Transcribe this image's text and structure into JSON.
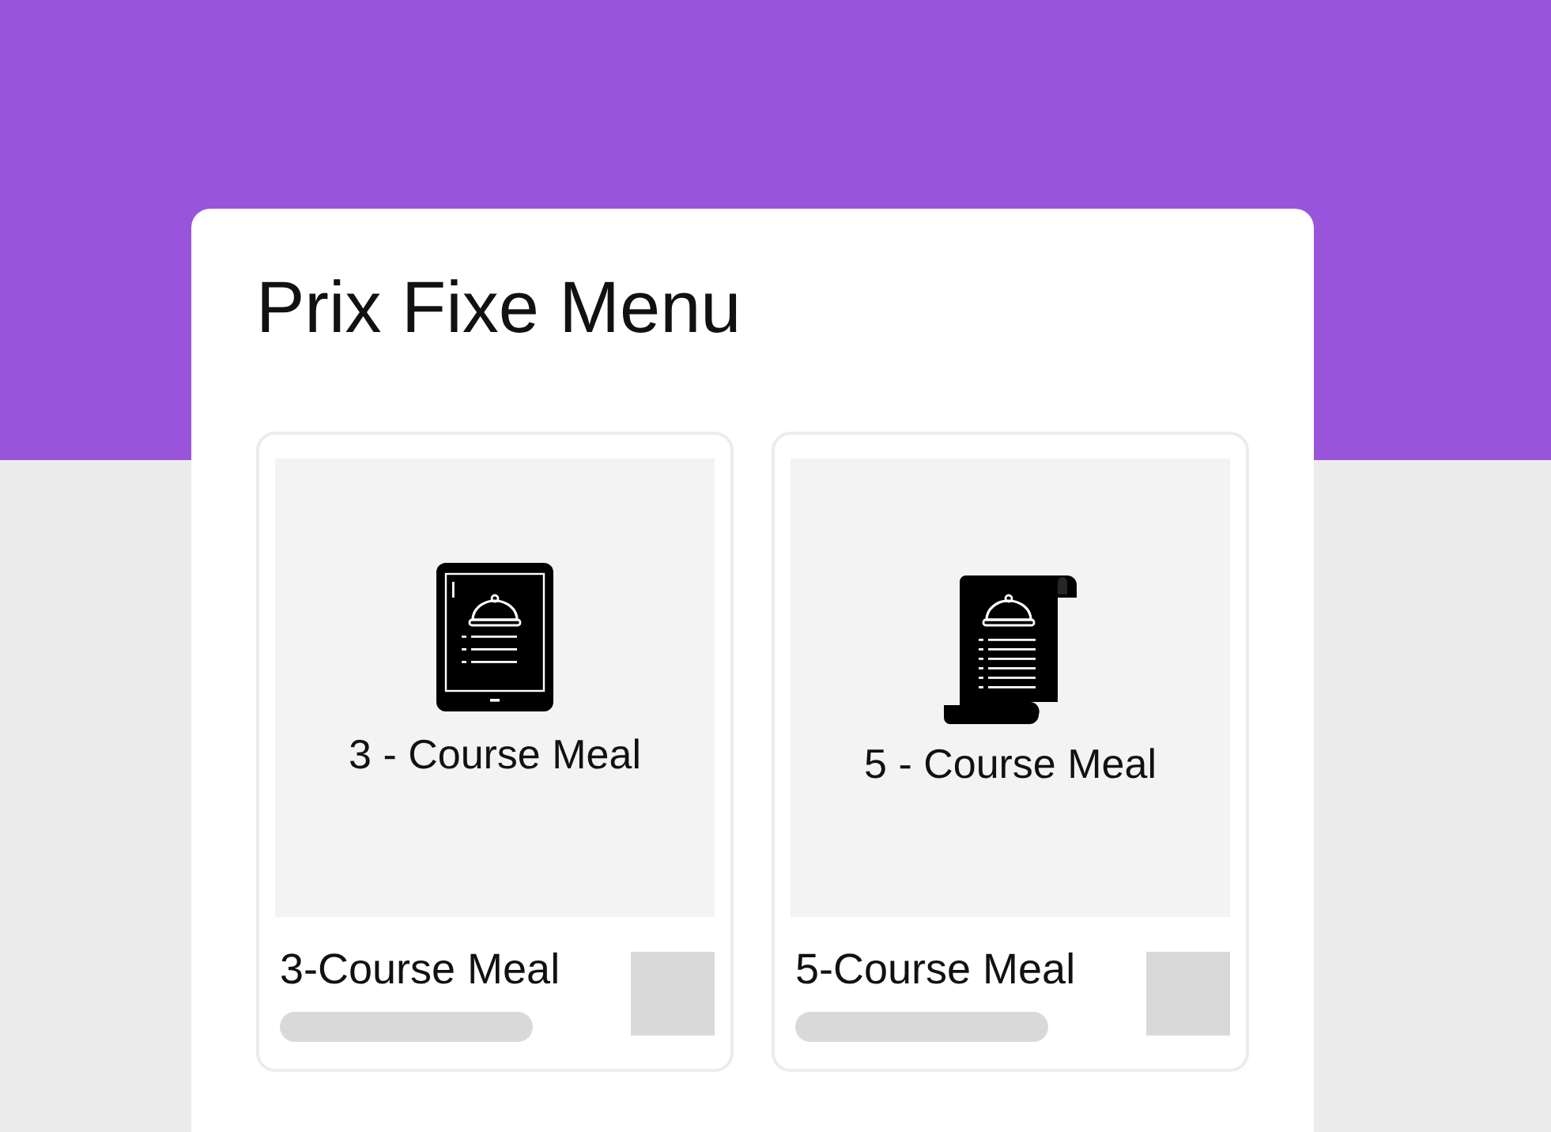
{
  "title": "Prix Fixe Menu",
  "items": [
    {
      "kind": "tablet",
      "image_caption": "3 - Course Meal",
      "name": "3-Course Meal"
    },
    {
      "kind": "scroll",
      "image_caption": "5 - Course Meal",
      "name": "5-Course Meal"
    }
  ]
}
